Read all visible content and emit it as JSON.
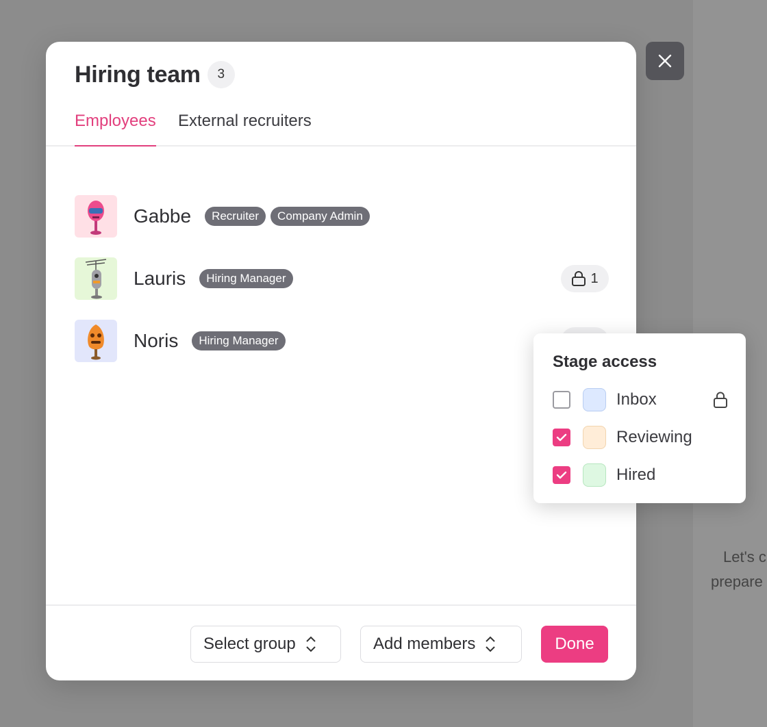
{
  "background": {
    "line1": "Let's c",
    "line2": "prepare"
  },
  "modal": {
    "title": "Hiring team",
    "count": "3",
    "tabs": [
      {
        "label": "Employees",
        "active": true
      },
      {
        "label": "External recruiters",
        "active": false
      }
    ]
  },
  "members": [
    {
      "name": "Gabbe",
      "roles": [
        "Recruiter",
        "Company Admin"
      ],
      "avatar_color": "#ffe0e6",
      "avatar_icon": "pink-robot-icon"
    },
    {
      "name": "Lauris",
      "roles": [
        "Hiring Manager"
      ],
      "avatar_color": "#e6f7d8",
      "avatar_icon": "antenna-robot-icon",
      "restricted_count": "1"
    },
    {
      "name": "Noris",
      "roles": [
        "Hiring Manager"
      ],
      "avatar_color": "#e2e6fb",
      "avatar_icon": "orange-robot-icon"
    }
  ],
  "footer": {
    "select_group": "Select group",
    "add_members": "Add members",
    "done": "Done"
  },
  "stage_access": {
    "title": "Stage access",
    "stages": [
      {
        "label": "Inbox",
        "checked": false,
        "color": "#dde9ff",
        "locked": true
      },
      {
        "label": "Reviewing",
        "checked": true,
        "color": "#ffedd8",
        "locked": false
      },
      {
        "label": "Hired",
        "checked": true,
        "color": "#def8e2",
        "locked": false
      }
    ]
  },
  "colors": {
    "accent": "#ec3d82",
    "badge": "#6e6e76"
  }
}
